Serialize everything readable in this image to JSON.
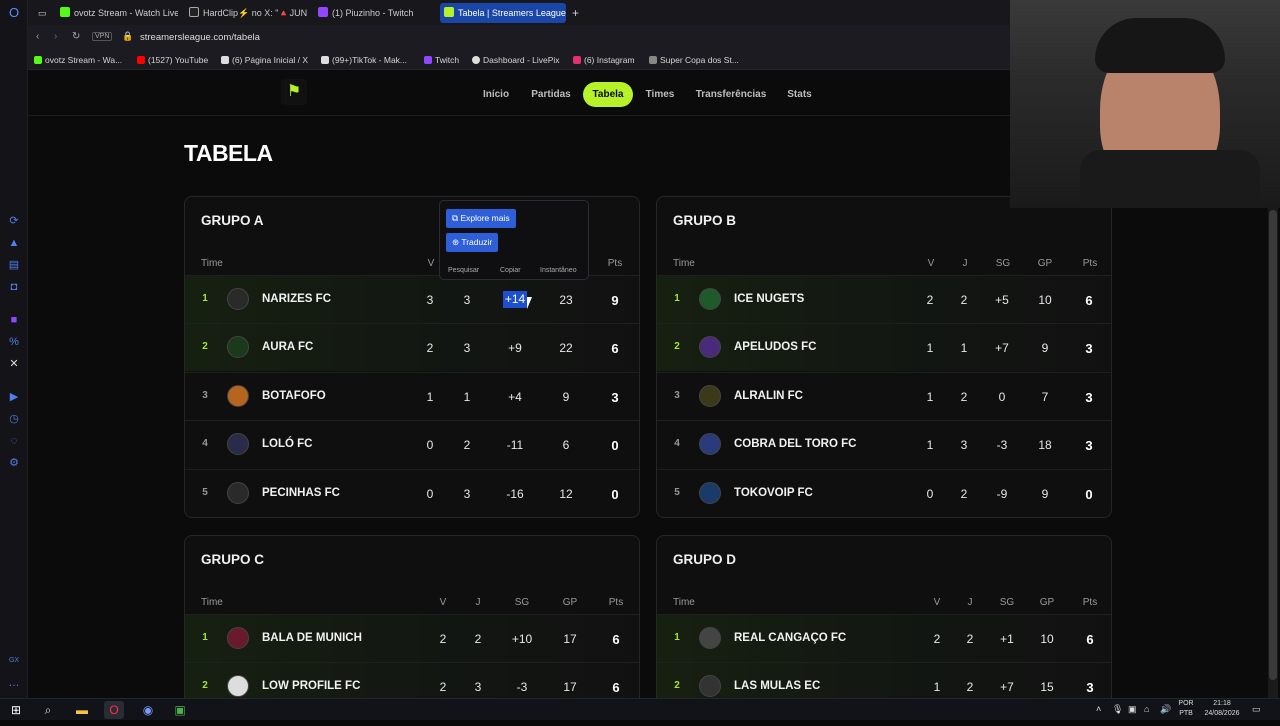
{
  "browser": {
    "tabs": [
      {
        "label": "ovotz Stream - Watch Live",
        "color": "#53fc18"
      },
      {
        "label": "HardClip⚡ no X: \"🔺JUN",
        "color": "#ffffff"
      },
      {
        "label": "(1) Piuzinho - Twitch",
        "color": "#9146ff"
      },
      {
        "label": "Tabela | Streamers League",
        "color": "#b6f22a"
      }
    ],
    "new_tab": "+",
    "vpn": "VPN",
    "url": "streamersleague.com/tabela",
    "bookmarks": [
      {
        "label": "ovotz Stream - Wa...",
        "color": "#53fc18"
      },
      {
        "label": "(1527) YouTube",
        "color": "#ff0000"
      },
      {
        "label": "(6) Página Inicial / X",
        "color": "#ffffff"
      },
      {
        "label": "(99+)TikTok - Mak...",
        "color": "#ffffff"
      },
      {
        "label": "Twitch",
        "color": "#9146ff"
      },
      {
        "label": "Dashboard - LivePix",
        "color": "#dddddd"
      },
      {
        "label": "(6) Instagram",
        "color": "#e1306c"
      },
      {
        "label": "Super Copa dos St...",
        "color": "#aaaaaa"
      }
    ]
  },
  "site": {
    "nav": [
      "Início",
      "Partidas",
      "Tabela",
      "Times",
      "Transferências",
      "Stats"
    ],
    "active_nav": "Tabela",
    "page_title": "TABELA",
    "accent": "#b6f22a",
    "col_headers": {
      "team": "Time",
      "v": "V",
      "j": "J",
      "sg": "SG",
      "gp": "GP",
      "pts": "Pts"
    }
  },
  "groups": [
    {
      "title": "GRUPO A",
      "rows": [
        {
          "pos": "1",
          "team": "NARIZES FC",
          "v": "3",
          "j": "3",
          "sg": "+14",
          "gp": "23",
          "pts": "9"
        },
        {
          "pos": "2",
          "team": "AURA FC",
          "v": "2",
          "j": "3",
          "sg": "+9",
          "gp": "22",
          "pts": "6"
        },
        {
          "pos": "3",
          "team": "BOTAFOFO",
          "v": "1",
          "j": "1",
          "sg": "+4",
          "gp": "9",
          "pts": "3"
        },
        {
          "pos": "4",
          "team": "LOLÓ FC",
          "v": "0",
          "j": "2",
          "sg": "-11",
          "gp": "6",
          "pts": "0"
        },
        {
          "pos": "5",
          "team": "PECINHAS FC",
          "v": "0",
          "j": "3",
          "sg": "-16",
          "gp": "12",
          "pts": "0"
        }
      ]
    },
    {
      "title": "GRUPO B",
      "rows": [
        {
          "pos": "1",
          "team": "ICE NUGETS",
          "v": "2",
          "j": "2",
          "sg": "+5",
          "gp": "10",
          "pts": "6"
        },
        {
          "pos": "2",
          "team": "APELUDOS FC",
          "v": "1",
          "j": "1",
          "sg": "+7",
          "gp": "9",
          "pts": "3"
        },
        {
          "pos": "3",
          "team": "ALRALIN FC",
          "v": "1",
          "j": "2",
          "sg": "0",
          "gp": "7",
          "pts": "3"
        },
        {
          "pos": "4",
          "team": "COBRA DEL TORO FC",
          "v": "1",
          "j": "3",
          "sg": "-3",
          "gp": "18",
          "pts": "3"
        },
        {
          "pos": "5",
          "team": "TOKOVOIP FC",
          "v": "0",
          "j": "2",
          "sg": "-9",
          "gp": "9",
          "pts": "0"
        }
      ]
    },
    {
      "title": "GRUPO C",
      "rows": [
        {
          "pos": "1",
          "team": "BALA DE MUNICH",
          "v": "2",
          "j": "2",
          "sg": "+10",
          "gp": "17",
          "pts": "6"
        },
        {
          "pos": "2",
          "team": "LOW PROFILE FC",
          "v": "2",
          "j": "3",
          "sg": "-3",
          "gp": "17",
          "pts": "6"
        }
      ]
    },
    {
      "title": "GRUPO D",
      "rows": [
        {
          "pos": "1",
          "team": "REAL CANGAÇO FC",
          "v": "2",
          "j": "2",
          "sg": "+1",
          "gp": "10",
          "pts": "6"
        },
        {
          "pos": "2",
          "team": "LAS MULAS EC",
          "v": "1",
          "j": "2",
          "sg": "+7",
          "gp": "15",
          "pts": "3"
        }
      ]
    }
  ],
  "popup": {
    "explore": "Explore mais",
    "translate": "Traduzir",
    "search": "Pesquisar",
    "copy": "Copiar",
    "snapshot": "Instantâneo"
  },
  "taskbar": {
    "lang_top": "POR",
    "lang_bottom": "PTB",
    "time": "21:18",
    "date": "24/08/2026"
  }
}
